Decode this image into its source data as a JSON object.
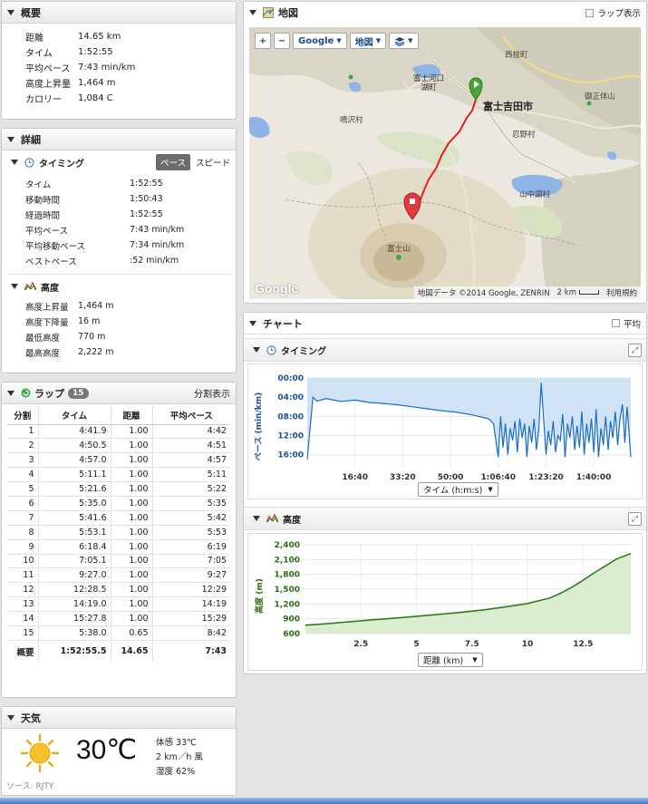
{
  "summary": {
    "title": "概要",
    "rows": [
      {
        "label": "距離",
        "value": "14.65 km"
      },
      {
        "label": "タイム",
        "value": "1:52:55"
      },
      {
        "label": "平均ペース",
        "value": "7:43 min/km"
      },
      {
        "label": "高度上昇量",
        "value": "1,464 m"
      },
      {
        "label": "カロリー",
        "value": "1,084 C"
      }
    ]
  },
  "details": {
    "title": "詳細",
    "timing": {
      "title": "タイミング",
      "pace_toggle": "ペース",
      "speed_toggle": "スピード",
      "rows": [
        {
          "label": "タイム",
          "value": "1:52:55"
        },
        {
          "label": "移動時間",
          "value": "1:50:43"
        },
        {
          "label": "経過時間",
          "value": "1:52:55"
        },
        {
          "label": "平均ペース",
          "value": "7:43 min/km"
        },
        {
          "label": "平均移動ペース",
          "value": "7:34 min/km"
        },
        {
          "label": "ベストペース",
          "value": ":52 min/km"
        }
      ]
    },
    "elevation": {
      "title": "高度",
      "rows": [
        {
          "label": "高度上昇量",
          "value": "1,464 m"
        },
        {
          "label": "高度下降量",
          "value": "16 m"
        },
        {
          "label": "最低高度",
          "value": "770 m"
        },
        {
          "label": "最高高度",
          "value": "2,222 m"
        }
      ]
    }
  },
  "laps": {
    "title": "ラップ",
    "count": "15",
    "split_view": "分割表示",
    "headers": [
      "分割",
      "タイム",
      "距離",
      "平均ペース"
    ],
    "rows": [
      [
        "1",
        "4:41.9",
        "1.00",
        "4:42"
      ],
      [
        "2",
        "4:50.5",
        "1.00",
        "4:51"
      ],
      [
        "3",
        "4:57.0",
        "1.00",
        "4:57"
      ],
      [
        "4",
        "5:11.1",
        "1.00",
        "5:11"
      ],
      [
        "5",
        "5:21.6",
        "1.00",
        "5:22"
      ],
      [
        "6",
        "5:35.0",
        "1.00",
        "5:35"
      ],
      [
        "7",
        "5:41.6",
        "1.00",
        "5:42"
      ],
      [
        "8",
        "5:53.1",
        "1.00",
        "5:53"
      ],
      [
        "9",
        "6:18.4",
        "1.00",
        "6:19"
      ],
      [
        "10",
        "7:05.1",
        "1.00",
        "7:05"
      ],
      [
        "11",
        "9:27.0",
        "1.00",
        "9:27"
      ],
      [
        "12",
        "12:28.5",
        "1.00",
        "12:29"
      ],
      [
        "13",
        "14:19.0",
        "1.00",
        "14:19"
      ],
      [
        "14",
        "15:27.8",
        "1.00",
        "15:29"
      ],
      [
        "15",
        "5:38.0",
        "0.65",
        "8:42"
      ]
    ],
    "total": [
      "概要",
      "1:52:55.5",
      "14.65",
      "7:43"
    ]
  },
  "weather": {
    "title": "天気",
    "temp": "30℃",
    "feels": "体感 33℃",
    "wind": "2 km／h 風",
    "humidity": "湿度 62%",
    "source": "ソース: RJTY",
    "icon": "sun-icon"
  },
  "map": {
    "title": "地図",
    "lap_display": "ラップ表示",
    "zoom_in": "+",
    "zoom_out": "−",
    "provider": "Google",
    "map_type": "地図",
    "labels": [
      "西桂町",
      "富士河口湖町",
      "富士吉田市",
      "御正体山",
      "鳴沢村",
      "忍野村",
      "山中湖村",
      "富士山"
    ],
    "attribution": "地図データ ©2014 Google, ZENRIN",
    "scale": "2 km",
    "terms": "利用規約",
    "logo": "Google"
  },
  "chart_panel": {
    "title": "チャート",
    "average": "平均"
  },
  "colors": {
    "pace_line": "#1a6fc4",
    "pace_fill": "#cfe2f6",
    "elev_line": "#2e7d1c",
    "elev_fill": "#dbeccf",
    "route": "#e02020",
    "axis_text_pace": "#1c4f9a",
    "axis_text_elev": "#2e6b12"
  },
  "chart_data": [
    {
      "type": "area",
      "title": "タイミング",
      "ylabel": "ペース (min/km)",
      "xlabel": "タイム (h:m:s)",
      "yticks": [
        "00:00",
        "04:00",
        "08:00",
        "12:00",
        "16:00"
      ],
      "xticks": [
        "16:40",
        "33:20",
        "50:00",
        "1:06:40",
        "1:23:20",
        "1:40:00"
      ],
      "ylim_min": [
        0,
        18.7
      ],
      "xlim_sec": [
        0,
        6775
      ],
      "x": [
        0,
        120,
        200,
        400,
        700,
        1000,
        1300,
        1600,
        1900,
        2200,
        2500,
        2800,
        3100,
        3400,
        3600,
        3800,
        3900,
        4000,
        4050,
        4100,
        4150,
        4200,
        4250,
        4300,
        4350,
        4400,
        4450,
        4500,
        4550,
        4600,
        4650,
        4700,
        4750,
        4800,
        4850,
        4900,
        4950,
        5000,
        5050,
        5100,
        5150,
        5200,
        5250,
        5300,
        5350,
        5400,
        5450,
        5500,
        5550,
        5600,
        5650,
        5700,
        5750,
        5800,
        5850,
        5900,
        5950,
        6000,
        6050,
        6100,
        6150,
        6200,
        6250,
        6300,
        6350,
        6400,
        6450,
        6500,
        6550,
        6600,
        6650,
        6700,
        6775
      ],
      "values": [
        17,
        4,
        4.8,
        4.3,
        4.9,
        4.6,
        5.1,
        5.3,
        5.6,
        6.0,
        6.4,
        6.8,
        7.1,
        7.6,
        8.0,
        8.5,
        9.5,
        16.5,
        8.0,
        14.5,
        9.5,
        16.0,
        10.5,
        13.0,
        9.0,
        15.5,
        8.5,
        12.5,
        9.5,
        16.5,
        10.0,
        13.5,
        8.5,
        15.0,
        10.5,
        1.0,
        8.5,
        16.0,
        11.0,
        14.0,
        9.0,
        15.5,
        12.0,
        13.0,
        7.5,
        16.5,
        9.5,
        12.5,
        8.0,
        15.0,
        10.0,
        14.5,
        7.0,
        16.0,
        9.5,
        13.5,
        8.5,
        15.5,
        6.5,
        16.5,
        10.5,
        14.0,
        8.0,
        15.0,
        9.0,
        12.5,
        7.0,
        14.0,
        8.5,
        5.5,
        13.5,
        6.0,
        16.5
      ]
    },
    {
      "type": "area",
      "title": "高度",
      "ylabel": "高度 (m)",
      "xlabel": "距離 (km)",
      "yticks": [
        "2,400",
        "2,100",
        "1,800",
        "1,500",
        "1,200",
        "900",
        "600"
      ],
      "xticks": [
        "2.5",
        "5",
        "7.5",
        "10",
        "12.5"
      ],
      "ylim": [
        600,
        2400
      ],
      "xlim": [
        0,
        14.65
      ],
      "x": [
        0,
        1,
        2,
        3,
        4,
        5,
        6,
        7,
        8,
        9,
        10,
        11,
        11.5,
        12,
        12.5,
        13,
        13.5,
        14,
        14.65
      ],
      "values": [
        770,
        800,
        840,
        880,
        910,
        950,
        990,
        1030,
        1080,
        1140,
        1210,
        1320,
        1420,
        1540,
        1680,
        1830,
        1970,
        2110,
        2222
      ]
    }
  ]
}
